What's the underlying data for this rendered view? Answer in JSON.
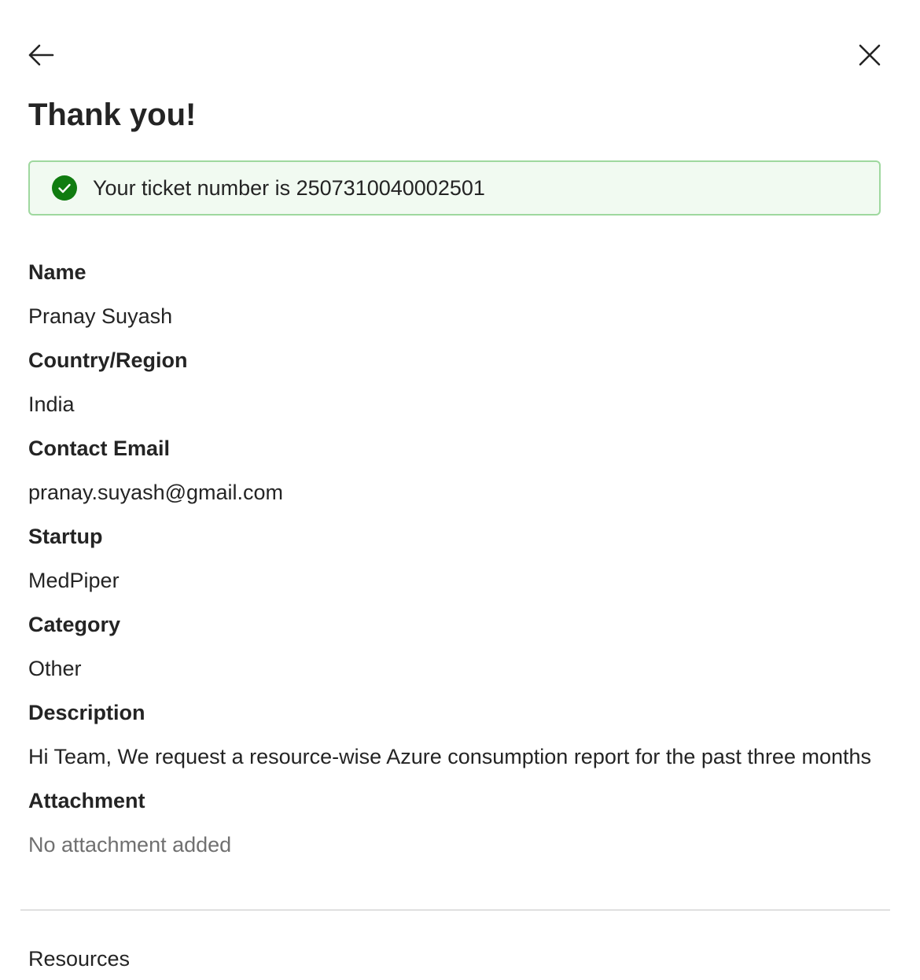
{
  "header": {
    "back_icon": "arrow-left-icon",
    "close_icon": "close-icon",
    "title": "Thank you!"
  },
  "banner": {
    "icon": "checkmark-circle-icon",
    "text": "Your ticket number is 2507310040002501",
    "colors": {
      "border": "#9fd89f",
      "background": "#f1faf1",
      "icon": "#107c10"
    }
  },
  "fields": {
    "name": {
      "label": "Name",
      "value": "Pranay Suyash"
    },
    "country": {
      "label": "Country/Region",
      "value": "India"
    },
    "email": {
      "label": "Contact Email",
      "value": "pranay.suyash@gmail.com"
    },
    "startup": {
      "label": "Startup",
      "value": "MedPiper"
    },
    "category": {
      "label": "Category",
      "value": "Other"
    },
    "description": {
      "label": "Description",
      "value": "Hi Team, We request a resource-wise Azure consumption report for the past three months"
    },
    "attachment": {
      "label": "Attachment",
      "value": "No attachment added"
    }
  },
  "footer": {
    "resources_label": "Resources"
  }
}
